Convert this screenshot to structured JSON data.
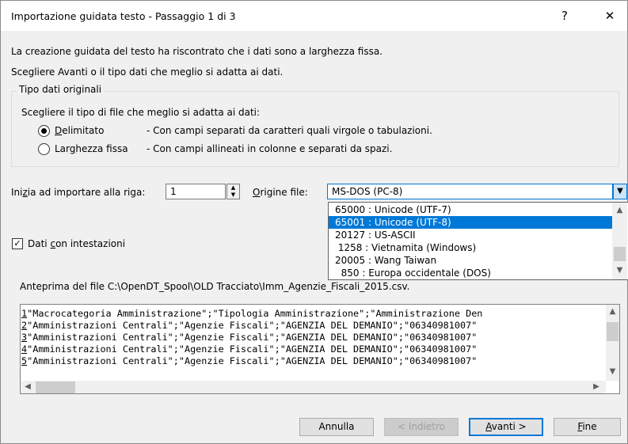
{
  "window": {
    "title": "Importazione guidata testo - Passaggio 1 di 3",
    "help_glyph": "?",
    "close_glyph": "✕"
  },
  "intro": {
    "line1": "La creazione guidata del testo ha riscontrato che i dati sono a larghezza fissa.",
    "line2": "Scegliere Avanti o il tipo dati che meglio si adatta ai dati."
  },
  "data_type_group": {
    "legend": "Tipo dati originali",
    "prompt": "Scegliere il tipo di file che meglio si adatta ai dati:",
    "options": [
      {
        "label_first": "D",
        "label_rest": "elimitato",
        "desc": "- Con campi separati da caratteri quali virgole o tabulazioni.",
        "checked": true
      },
      {
        "label_pre": "Lar",
        "label_acc": "g",
        "label_post": "hezza fissa",
        "desc": "- Con campi allineati in colonne e separati da spazi.",
        "checked": false
      }
    ]
  },
  "start_row": {
    "label_pre": "Ini",
    "label_acc": "z",
    "label_post": "ia ad importare alla riga:",
    "value": "1"
  },
  "origin": {
    "label_acc": "O",
    "label_post": "rigine file:",
    "selected": "MS-DOS (PC-8)",
    "options": [
      "65000 : Unicode (UTF-7)",
      "65001 : Unicode (UTF-8)",
      "20127 : US-ASCII",
      " 1258 : Vietnamita (Windows)",
      "20005 : Wang Taiwan",
      "  850 : Europa occidentale (DOS)"
    ],
    "highlighted_index": 1
  },
  "headers_checkbox": {
    "label_pre": "Dati ",
    "label_acc": "c",
    "label_post": "on intestazioni",
    "checked": true
  },
  "preview": {
    "label": "Anteprima del file C:\\OpenDT_Spool\\OLD Tracciato\\Imm_Agenzie_Fiscali_2015.csv.",
    "rows": [
      {
        "n": "1",
        "text": "\"Macrocategoria Amministrazione\";\"Tipologia Amministrazione\";\"Amministrazione Den"
      },
      {
        "n": "2",
        "text": "\"Amministrazioni Centrali\";\"Agenzie Fiscali\";\"AGENZIA DEL DEMANIO\";\"06340981007\""
      },
      {
        "n": "3",
        "text": "\"Amministrazioni Centrali\";\"Agenzie Fiscali\";\"AGENZIA DEL DEMANIO\";\"06340981007\""
      },
      {
        "n": "4",
        "text": "\"Amministrazioni Centrali\";\"Agenzie Fiscali\";\"AGENZIA DEL DEMANIO\";\"06340981007\""
      },
      {
        "n": "5",
        "text": "\"Amministrazioni Centrali\";\"Agenzie Fiscali\";\"AGENZIA DEL DEMANIO\";\"06340981007\""
      }
    ]
  },
  "buttons": {
    "cancel": "Annulla",
    "back": "< Indietro",
    "next_acc": "A",
    "next_rest": "vanti >",
    "finish_acc": "F",
    "finish_rest": "ine"
  },
  "colors": {
    "accent": "#0078d7",
    "selection_text": "#ffffff"
  }
}
